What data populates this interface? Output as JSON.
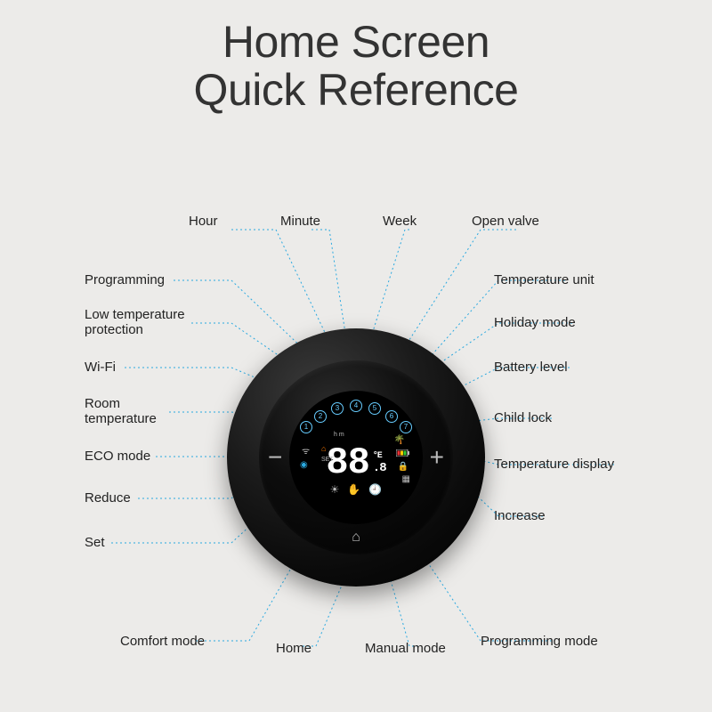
{
  "title": {
    "line1": "Home Screen",
    "line2": "Quick Reference"
  },
  "device": {
    "temp_main": "88",
    "temp_sub": ".8",
    "unit": "°E",
    "hm_label": "h m",
    "set_label": "SET",
    "arc_nums": [
      "1",
      "2",
      "3",
      "4",
      "5",
      "6",
      "7"
    ]
  },
  "callouts": {
    "top": [
      {
        "id": "hour",
        "label": "Hour"
      },
      {
        "id": "minute",
        "label": "Minute"
      },
      {
        "id": "week",
        "label": "Week"
      },
      {
        "id": "open_valve",
        "label": "Open valve"
      }
    ],
    "left": [
      {
        "id": "programming",
        "label": "Programming"
      },
      {
        "id": "low_temp",
        "label": "Low temperature\nprotection"
      },
      {
        "id": "wifi",
        "label": "Wi-Fi"
      },
      {
        "id": "room_temp",
        "label": "Room\ntemperature"
      },
      {
        "id": "eco_mode",
        "label": "ECO mode"
      },
      {
        "id": "reduce",
        "label": "Reduce"
      },
      {
        "id": "set",
        "label": "Set"
      }
    ],
    "right": [
      {
        "id": "temp_unit",
        "label": "Temperature unit"
      },
      {
        "id": "holiday",
        "label": "Holiday mode"
      },
      {
        "id": "battery",
        "label": "Battery level"
      },
      {
        "id": "child_lock",
        "label": "Child lock"
      },
      {
        "id": "temp_display",
        "label": "Temperature display"
      },
      {
        "id": "increase",
        "label": "Increase"
      }
    ],
    "bottom": [
      {
        "id": "comfort",
        "label": "Comfort  mode"
      },
      {
        "id": "home",
        "label": "Home"
      },
      {
        "id": "manual",
        "label": "Manual mode"
      },
      {
        "id": "prog_mode",
        "label": "Programming mode"
      }
    ]
  }
}
